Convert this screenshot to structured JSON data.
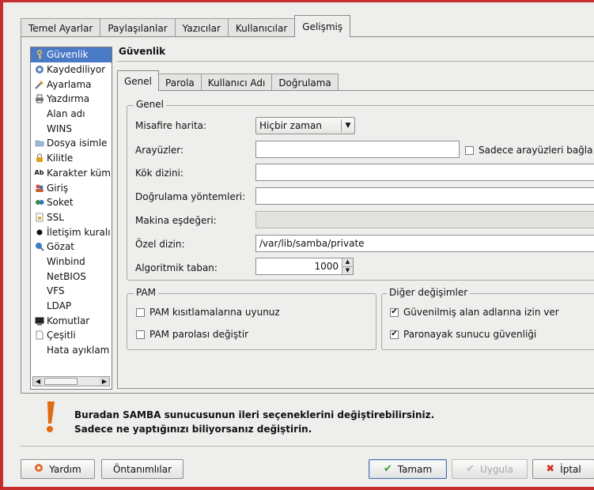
{
  "tabs": [
    {
      "label": "Temel Ayarlar"
    },
    {
      "label": "Paylaşılanlar"
    },
    {
      "label": "Yazıcılar"
    },
    {
      "label": "Kullanıcılar"
    },
    {
      "label": "Gelişmiş"
    }
  ],
  "sidebar": {
    "items": [
      {
        "label": "Güvenlik",
        "icon": "key-icon"
      },
      {
        "label": "Kaydediliyor",
        "icon": "log-icon"
      },
      {
        "label": "Ayarlama",
        "icon": "tune-icon"
      },
      {
        "label": "Yazdırma",
        "icon": "printer-icon"
      },
      {
        "label": "Alan adı",
        "icon": ""
      },
      {
        "label": "WINS",
        "icon": ""
      },
      {
        "label": "Dosya isimle",
        "icon": "folder-icon"
      },
      {
        "label": "Kilitle",
        "icon": "lock-icon"
      },
      {
        "label": "Karakter küm",
        "icon": "charset-icon"
      },
      {
        "label": "Giriş",
        "icon": "login-icon"
      },
      {
        "label": "Soket",
        "icon": "socket-icon"
      },
      {
        "label": "SSL",
        "icon": "ssl-icon"
      },
      {
        "label": "İletişim kuralı",
        "icon": "protocol-icon"
      },
      {
        "label": "Gözat",
        "icon": "browse-icon"
      },
      {
        "label": "Winbind",
        "icon": ""
      },
      {
        "label": "NetBIOS",
        "icon": ""
      },
      {
        "label": "VFS",
        "icon": ""
      },
      {
        "label": "LDAP",
        "icon": ""
      },
      {
        "label": "Komutlar",
        "icon": "terminal-icon"
      },
      {
        "label": "Çeşitli",
        "icon": "misc-icon"
      },
      {
        "label": "Hata ayıklam",
        "icon": ""
      }
    ]
  },
  "section": {
    "title": "Güvenlik"
  },
  "subtabs": [
    {
      "label": "Genel"
    },
    {
      "label": "Parola"
    },
    {
      "label": "Kullanıcı Adı"
    },
    {
      "label": "Doğrulama"
    }
  ],
  "genel": {
    "legend": "Genel",
    "guest_map_label": "Misafire harita:",
    "guest_map_value": "Hiçbir zaman",
    "interfaces_label": "Arayüzler:",
    "interfaces_value": "",
    "bind_only_label": "Sadece arayüzleri bağla",
    "root_dir_label": "Kök dizini:",
    "root_dir_value": "",
    "auth_methods_label": "Doğrulama yöntemleri:",
    "auth_methods_value": "",
    "machine_equiv_label": "Makina eşdeğeri:",
    "machine_equiv_value": "",
    "private_dir_label": "Özel dizin:",
    "private_dir_value": "/var/lib/samba/private",
    "algorithmic_base_label": "Algoritmik taban:",
    "algorithmic_base_value": "1000"
  },
  "pam": {
    "legend": "PAM",
    "restrictions_label": "PAM kısıtlamalarına uyunuz",
    "restrictions_checked": false,
    "password_change_label": "PAM parolası değiştir",
    "password_change_checked": false
  },
  "other": {
    "legend": "Diğer değişimler",
    "trusted_domains_label": "Güvenilmiş alan adlarına izin ver",
    "trusted_domains_checked": true,
    "paranoid_label": "Paronayak sunucu güvenliği",
    "paranoid_checked": true
  },
  "warning": {
    "line1": "Buradan SAMBA sunucusunun ileri seçeneklerini değiştirebilirsiniz.",
    "line2": "Sadece ne yaptığınızı biliyorsanız değiştirin."
  },
  "buttons": {
    "help": "Yardım",
    "defaults": "Öntanımlılar",
    "ok": "Tamam",
    "apply": "Uygula",
    "cancel": "İptal"
  },
  "colors": {
    "frame": "#c62d2d",
    "selection": "#4a79c6",
    "warning": "#e06a10"
  }
}
